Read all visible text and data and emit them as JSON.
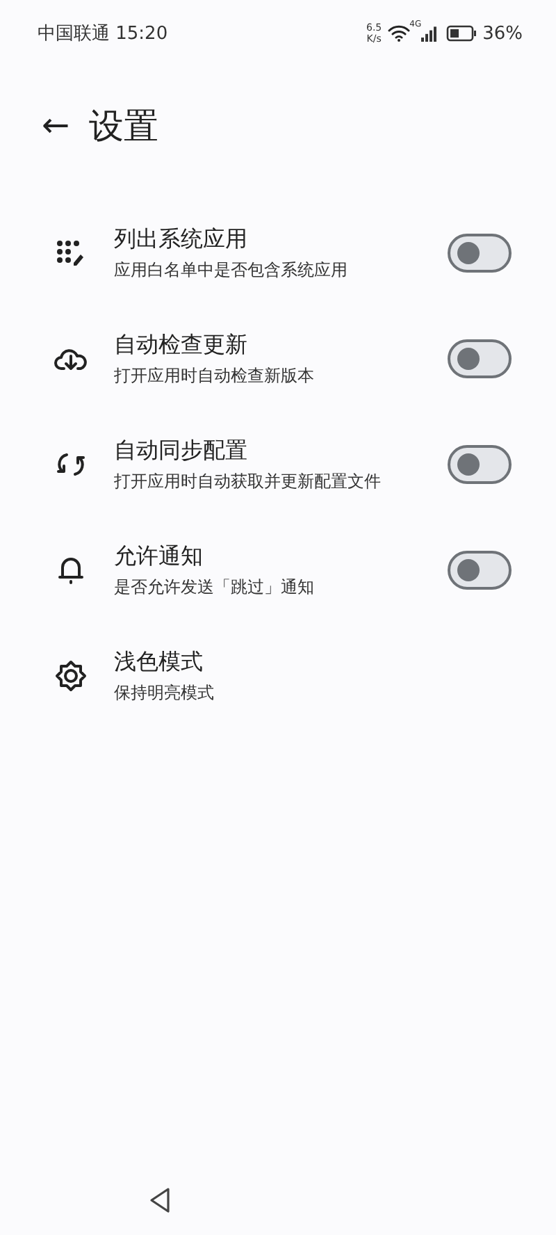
{
  "status_bar": {
    "carrier_time": "中国联通 15:20",
    "speed_value": "6.5",
    "speed_unit": "K/s",
    "network": "4G",
    "battery": "36%"
  },
  "header": {
    "back": "←",
    "title": "设置"
  },
  "settings": [
    {
      "kind": "switch",
      "title": "列出系统应用",
      "subtitle": "应用白名单中是否包含系统应用",
      "on": false
    },
    {
      "kind": "switch",
      "title": "自动检查更新",
      "subtitle": "打开应用时自动检查新版本",
      "on": false
    },
    {
      "kind": "switch",
      "title": "自动同步配置",
      "subtitle": "打开应用时自动获取并更新配置文件",
      "on": false
    },
    {
      "kind": "switch",
      "title": "允许通知",
      "subtitle": "是否允许发送「跳过」通知",
      "on": false
    },
    {
      "kind": "plain",
      "title": "浅色模式",
      "subtitle": "保持明亮模式"
    }
  ]
}
